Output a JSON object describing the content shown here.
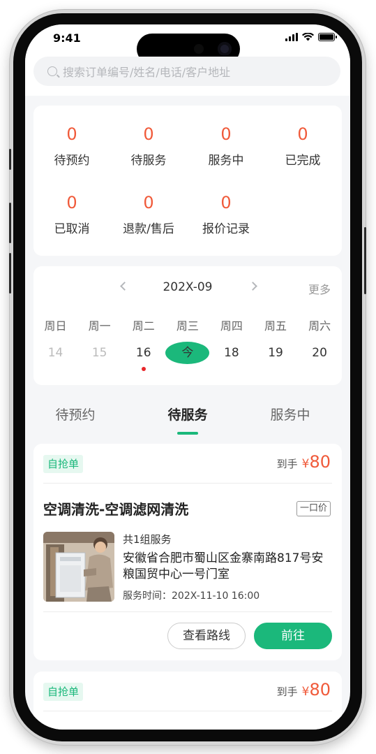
{
  "status_bar": {
    "time": "9:41"
  },
  "search": {
    "placeholder": "搜索订单编号/姓名/电话/客户地址"
  },
  "stats": [
    {
      "count": "0",
      "label": "待预约"
    },
    {
      "count": "0",
      "label": "待服务"
    },
    {
      "count": "0",
      "label": "服务中"
    },
    {
      "count": "0",
      "label": "已完成"
    },
    {
      "count": "0",
      "label": "已取消"
    },
    {
      "count": "0",
      "label": "退款/售后"
    },
    {
      "count": "0",
      "label": "报价记录"
    }
  ],
  "calendar": {
    "month": "202X-09",
    "more": "更多",
    "weekdays": [
      "周日",
      "周一",
      "周二",
      "周三",
      "周四",
      "周五",
      "周六"
    ],
    "days": [
      "14",
      "15",
      "16",
      "今",
      "18",
      "19",
      "20"
    ]
  },
  "tabs": [
    "待预约",
    "待服务",
    "服务中"
  ],
  "orders": [
    {
      "tag": "自抢单",
      "price_prefix": "到手",
      "currency": "¥",
      "price": "80",
      "title": "空调清洗-空调滤网清洗",
      "badge": "一口价",
      "group": "共1组服务",
      "address": "安徽省合肥市蜀山区金寨南路817号安粮国贸中心一号门室",
      "service_time": "服务时间：202X-11-10 16:00",
      "btn_route": "查看路线",
      "btn_go": "前往"
    },
    {
      "tag": "自抢单",
      "price_prefix": "到手",
      "currency": "¥",
      "price": "80"
    }
  ],
  "colors": {
    "accent": "#1bb87b",
    "price": "#f05a3a",
    "dot": "#e8262a"
  }
}
